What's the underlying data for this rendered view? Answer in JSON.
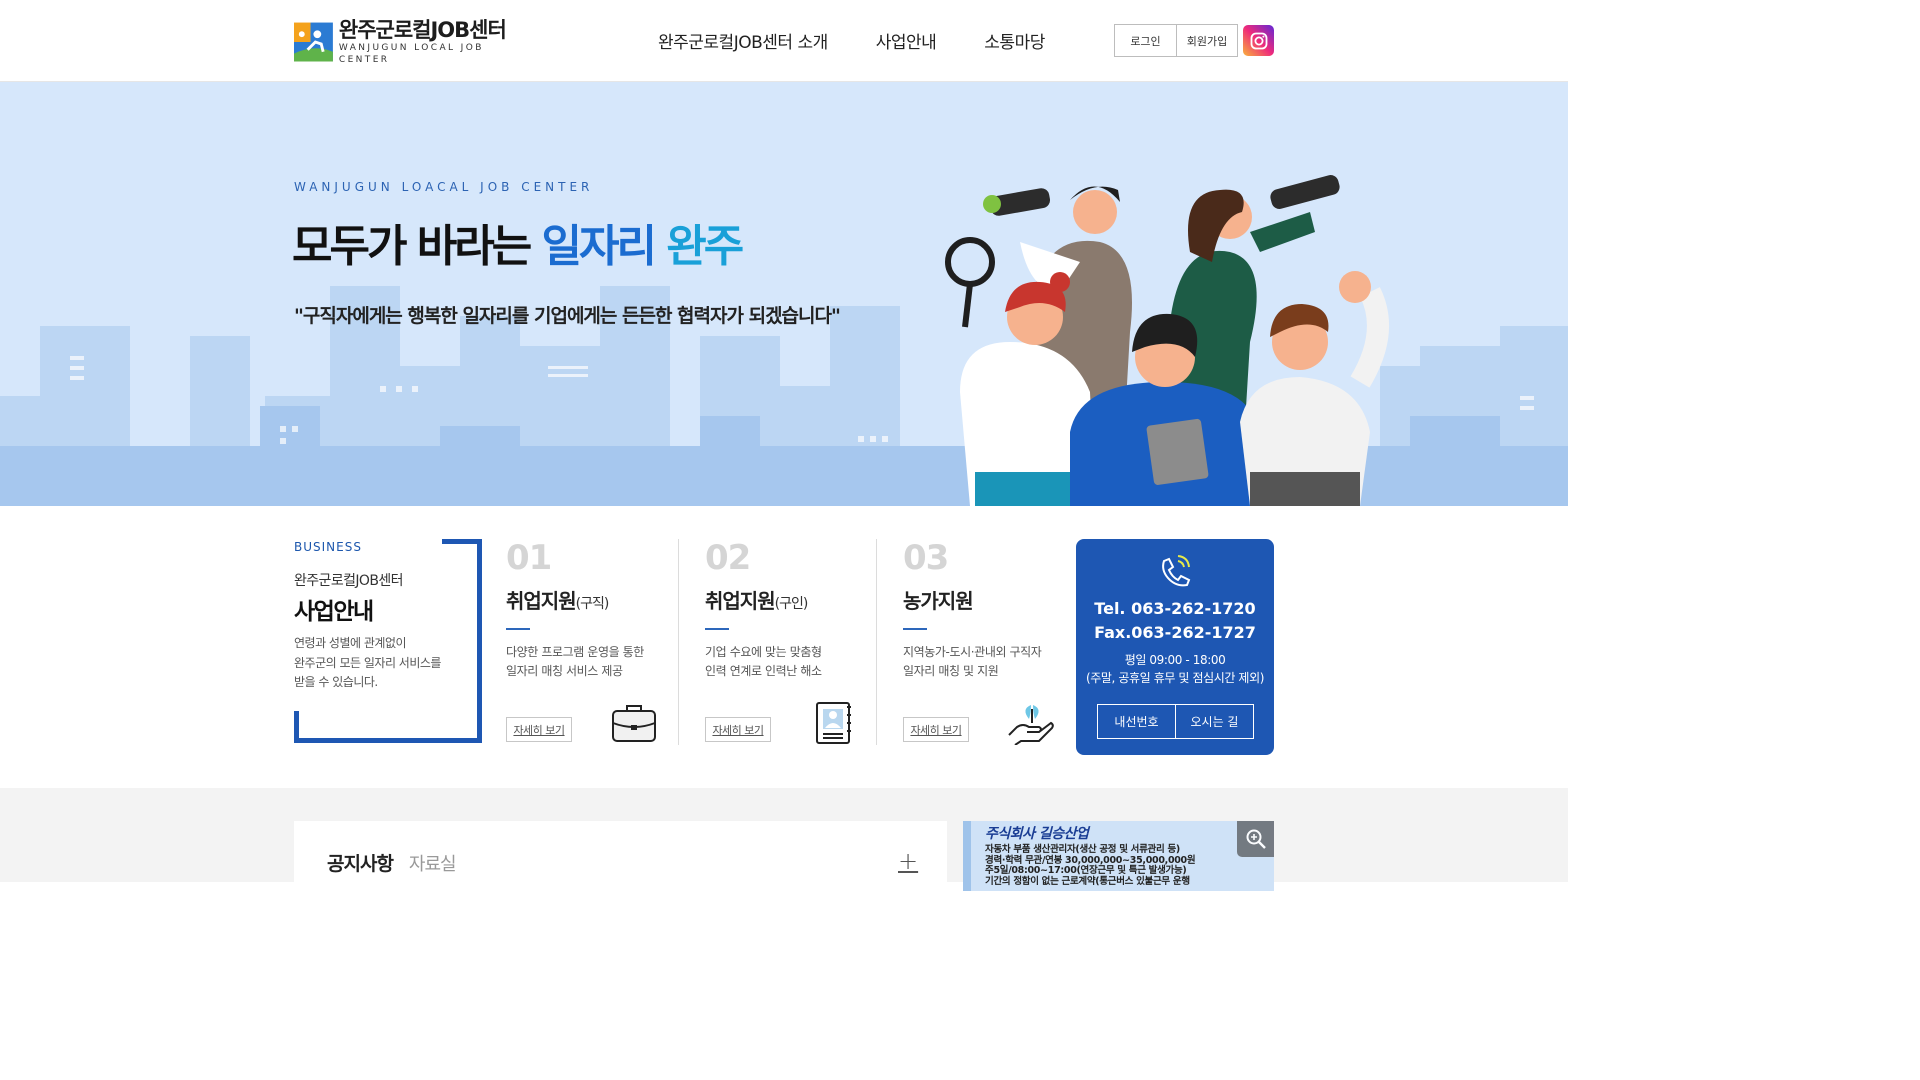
{
  "header": {
    "logo_title": "완주군로컬JOB센터",
    "logo_sub": "WANJUGUN LOCAL JOB CENTER",
    "nav": [
      "완주군로컬JOB센터 소개",
      "사업안내",
      "소통마당"
    ],
    "login_label": "로그인",
    "signup_label": "회원가입",
    "instagram_icon": "instagram-icon"
  },
  "hero": {
    "eyebrow": "WANJUGUN LOACAL JOB CENTER",
    "title_plain": "모두가 바라는 ",
    "title_highlight1": "일자리 ",
    "title_highlight2": "완주",
    "quote": "\"구직자에게는 행복한 일자리를 기업에게는 든든한 협력자가 되겠습니다\""
  },
  "business": {
    "eyebrow": "BUSINESS",
    "subtitle": "완주군로컬JOB센터",
    "title": "사업안내",
    "desc_line1": "연령과 성별에 관계없이",
    "desc_line2": "완주군의 모든 일자리 서비스를",
    "desc_line3": "받을 수 있습니다.",
    "cards": [
      {
        "num": "01",
        "title": "취업지원",
        "sub": "(구직)",
        "desc_line1": "다양한 프로그램 운영을 통한",
        "desc_line2": "일자리 매칭 서비스 제공",
        "more": "자세히 보기",
        "icon": "briefcase-icon"
      },
      {
        "num": "02",
        "title": "취업지원",
        "sub": "(구인)",
        "desc_line1": "기업 수요에 맞는 맞춤형",
        "desc_line2": "인력 연계로 인력난 해소",
        "more": "자세히 보기",
        "icon": "resume-icon"
      },
      {
        "num": "03",
        "title": "농가지원",
        "sub": "",
        "desc_line1": "지역농가-도시·관내외 구직자",
        "desc_line2": "일자리 매칭 및 지원",
        "more": "자세히 보기",
        "icon": "hand-plant-icon"
      }
    ],
    "contact": {
      "tel": "Tel. 063-262-1720",
      "fax": "Fax.063-262-1727",
      "hours": "평일 09:00 - 18:00",
      "hours_note": "(주말, 공휴일 휴무 및 점심시간 제외)",
      "btn_ext": "내선번호",
      "btn_way": "오시는 길"
    }
  },
  "board": {
    "tab_active": "공지사항",
    "tab_inactive": "자료실",
    "more_symbol": "+"
  },
  "popup": {
    "title": "주식회사 길승산업",
    "line1": "자동차 부품 생산관리자(생산 공정 및 서류관리 등)",
    "line2": "경력·학력 무관/연봉 30,000,000~35,000,000원",
    "line3": "주5일/08:00~17:00(연장근무 및 특근 발생가능)",
    "line4": "기간의 정함이 없는 근로계약(통근버스 있불근무 운행"
  },
  "colors": {
    "brand_blue": "#1e57b3",
    "hero_bg": "#d6e7fb",
    "highlight": "#1b6cd0"
  }
}
